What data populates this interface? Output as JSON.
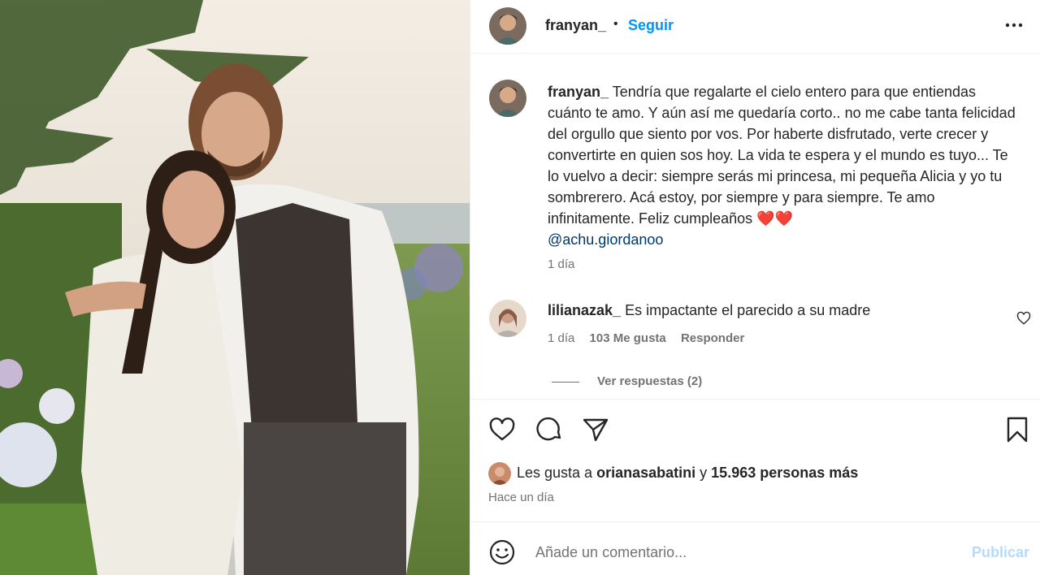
{
  "post": {
    "author": "franyan_",
    "separator": "•",
    "follow_label": "Seguir",
    "more_icon": "more-horizontal-icon"
  },
  "caption": {
    "user": "franyan_",
    "text": "Tendría que regalarte el cielo entero para que entiendas cuánto te amo. Y aún así me quedaría corto.. no me cabe tanta felicidad del orgullo que siento por vos. Por haberte disfrutado, verte crecer y convertirte en quien sos hoy. La vida te espera y el mundo es tuyo... Te lo vuelvo a decir: siempre serás mi princesa, mi pequeña Alicia y yo tu sombrerero. Acá estoy, por siempre y para siempre. Te amo infinitamente. Feliz cumpleaños",
    "emoji": "❤️❤️",
    "mention": "@achu.giordanoo",
    "time": "1 día"
  },
  "comment": {
    "user": "lilianazak_",
    "text": "Es impactante el parecido a su madre",
    "time": "1 día",
    "likes": "103 Me gusta",
    "reply_label": "Responder",
    "view_replies": "Ver respuestas (2)"
  },
  "actions": {
    "likes_prefix": "Les gusta a",
    "likes_user": "orianasabatini",
    "likes_joiner": "y",
    "likes_others": "15.963 personas más",
    "date": "Hace un día"
  },
  "composer": {
    "placeholder": "Añade un comentario...",
    "publish_label": "Publicar"
  },
  "colors": {
    "accent": "#0095f6",
    "publish_disabled": "#b3dbff",
    "mention": "#00376b",
    "secondary_text": "#737373"
  }
}
